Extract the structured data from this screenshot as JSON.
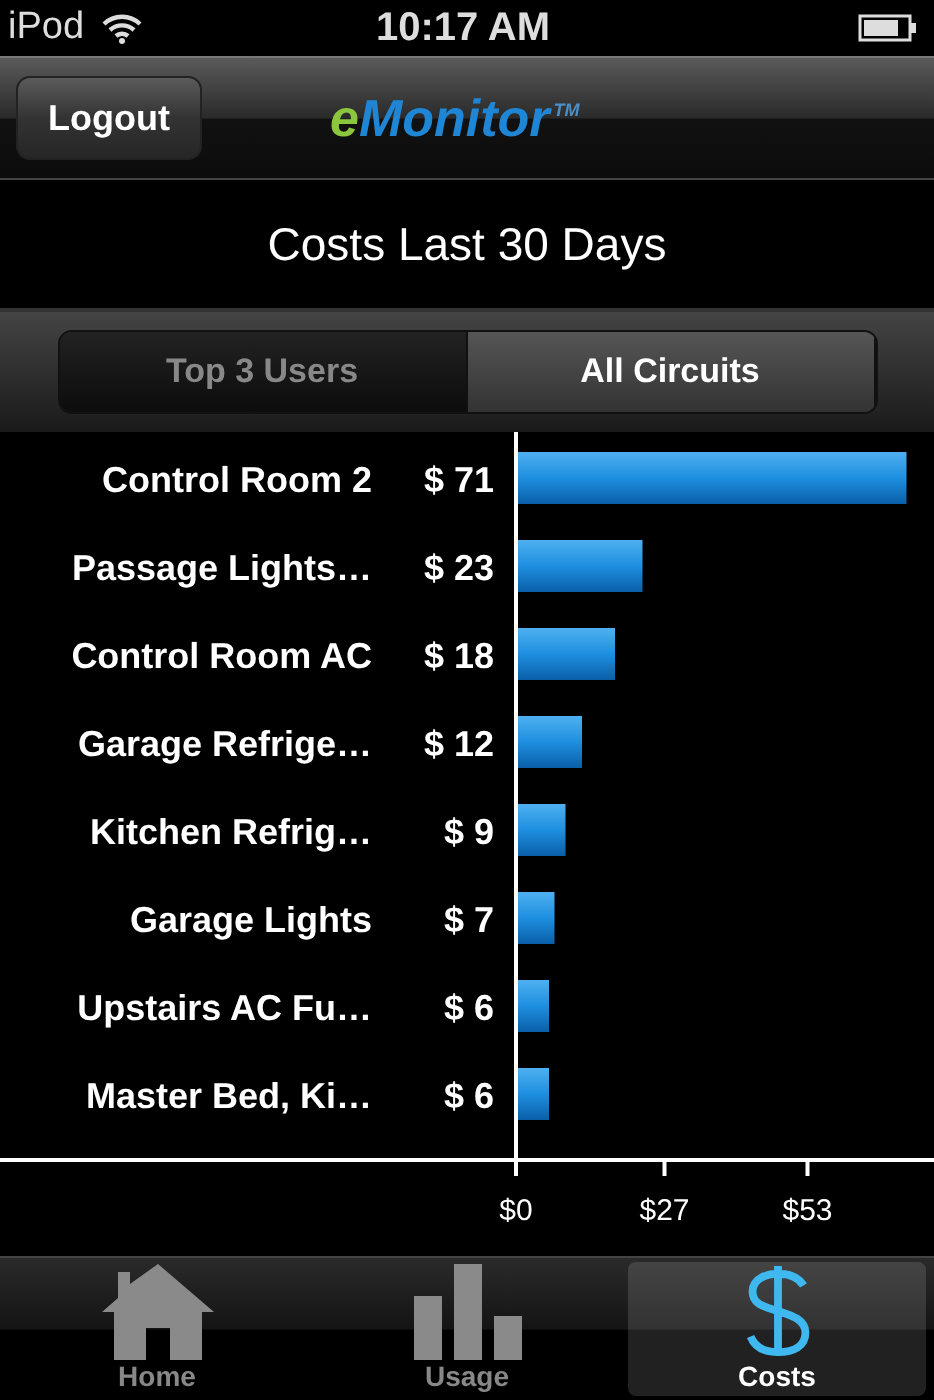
{
  "status_bar": {
    "carrier": "iPod",
    "time": "10:17 AM"
  },
  "nav_bar": {
    "button": "Logout",
    "logo": {
      "text": "eMonitor",
      "mark": "TM"
    }
  },
  "title": "Costs Last 30 Days",
  "segments": [
    {
      "label": "Top 3 Users",
      "selected": false
    },
    {
      "label": "All Circuits",
      "selected": true
    }
  ],
  "chart_data": {
    "type": "bar",
    "orientation": "horizontal",
    "categories": [
      "Control Room 2",
      "Passage Lights…",
      "Control Room AC",
      "Garage Refrige…",
      "Kitchen Refrig…",
      "Garage Lights",
      "Upstairs AC Fu…",
      "Master Bed, Ki…"
    ],
    "series": [
      {
        "color": "#1e8fe0",
        "values": [
          71,
          23,
          18,
          12,
          9,
          7,
          6,
          6
        ]
      }
    ],
    "value_labels": [
      "$ 71",
      "$ 23",
      "$ 18",
      "$ 12",
      "$ 9",
      "$ 7",
      "$ 6",
      "$ 6"
    ],
    "xlim": [
      0,
      76
    ],
    "xticks": [
      {
        "value": 0,
        "label": "$0"
      },
      {
        "value": 27,
        "label": "$27"
      },
      {
        "value": 53,
        "label": "$53"
      }
    ]
  },
  "tab_bar": [
    {
      "kind": "home",
      "label": "Home",
      "selected": false
    },
    {
      "kind": "usage",
      "label": "Usage",
      "selected": false
    },
    {
      "kind": "costs",
      "label": "Costs",
      "selected": true
    }
  ]
}
